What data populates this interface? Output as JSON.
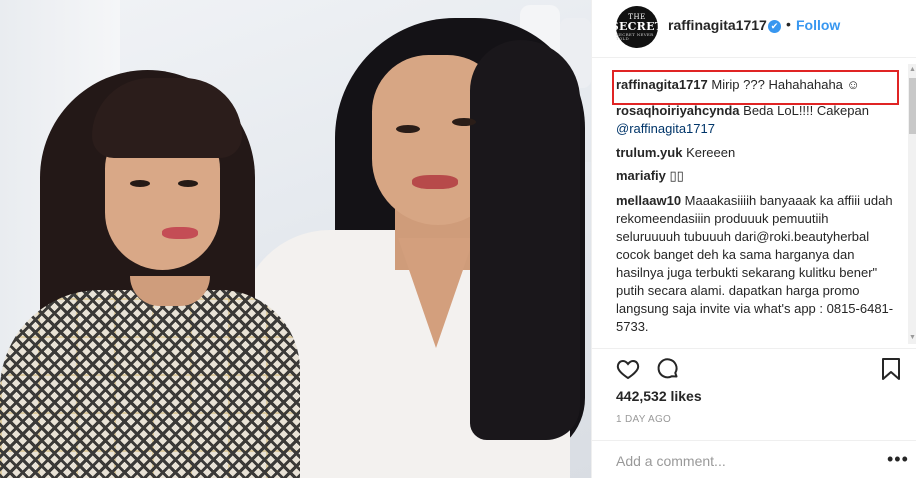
{
  "post": {
    "photo_alt": "Two women smiling"
  },
  "header": {
    "avatar_line1": "THE",
    "avatar_line2": "SECRET",
    "avatar_line3": "SECRET NEVER TOLD",
    "username": "raffinagita1717",
    "verified_glyph": "✔",
    "separator": "•",
    "follow_label": "Follow"
  },
  "comments": [
    {
      "user": "raffinagita1717",
      "text": " Mirip ??? Hahahahaha ☺"
    },
    {
      "user": "rosaqhoiriyahcynda",
      "text": " Beda LoL!!!! Cakepan ",
      "mention": "@raffinagita1717"
    },
    {
      "user": "trulum.yuk",
      "text": " Kereeen"
    },
    {
      "user": "mariafiy",
      "text": " ▯▯"
    },
    {
      "user": "mellaaw10",
      "text": " Maaakasiiiih banyaaak ka affiii udah rekomeendasiiin produuuk pemuutiih seluruuuuh tubuuuh dari@roki.beautyherbal cocok banget deh ka sama harganya dan hasilnya juga terbukti sekarang kulitku bener\" putih secara alami. dapatkan harga promo langsung saja invite via what's app : 0815-6481-5733."
    }
  ],
  "scrollbar": {
    "up": "▲",
    "down": "▼"
  },
  "actions": {
    "like_icon": "heart-icon",
    "comment_icon": "comment-icon",
    "save_icon": "bookmark-icon"
  },
  "likes": "442,532 likes",
  "timestamp": "1 DAY AGO",
  "add_comment": {
    "placeholder": "Add a comment...",
    "more_label": "•••"
  },
  "colors": {
    "link": "#3897f0",
    "highlight": "#e02424",
    "text": "#262626",
    "muted": "#999999"
  }
}
